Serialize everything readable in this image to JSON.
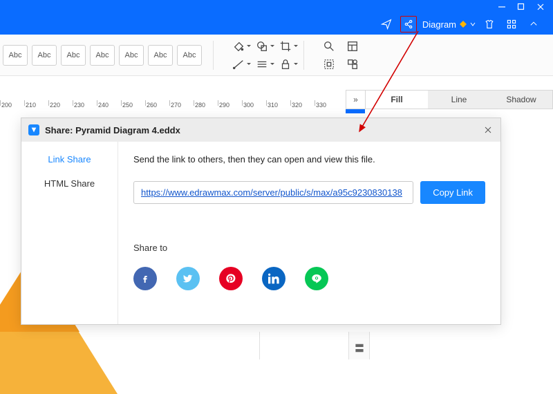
{
  "window_controls": [
    "minimize",
    "maximize",
    "close"
  ],
  "header": {
    "diagram_label": "Diagram"
  },
  "toolbar": {
    "abc_label": "Abc",
    "abc_count": 7
  },
  "panel_tabs": {
    "expand": "»",
    "fill": "Fill",
    "line": "Line",
    "shadow": "Shadow"
  },
  "ruler": {
    "start": 200,
    "step": 10,
    "count": 14
  },
  "dialog": {
    "title": "Share: Pyramid Diagram 4.eddx",
    "sidebar": {
      "link_share": "Link Share",
      "html_share": "HTML Share"
    },
    "desc": "Send the link to others, then they can open and view this file.",
    "link": "https://www.edrawmax.com/server/public/s/max/a95c9230830138",
    "copy_label": "Copy Link",
    "share_to_label": "Share to",
    "social": [
      "facebook",
      "twitter",
      "pinterest",
      "linkedin",
      "line"
    ]
  }
}
